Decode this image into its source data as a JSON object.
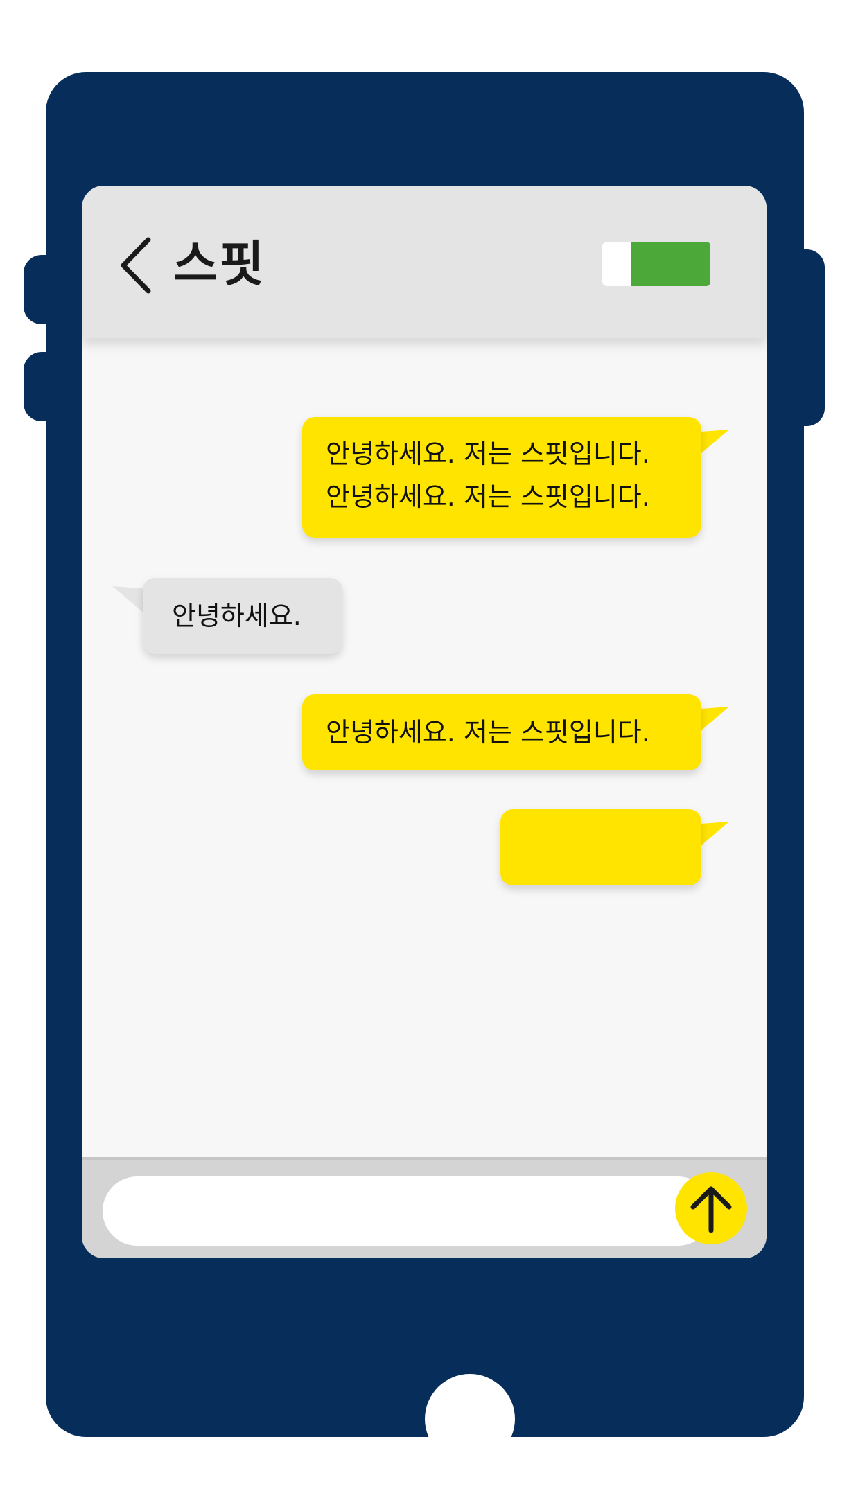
{
  "header": {
    "contact_name": "스핏",
    "back_icon": "chevron-left-icon"
  },
  "toggle": {
    "state": "on",
    "on_color": "#4da83a"
  },
  "messages": [
    {
      "sender": "me",
      "lines": [
        "안녕하세요. 저는 스핏입니다.",
        "안녕하세요. 저는 스핏입니다."
      ]
    },
    {
      "sender": "other",
      "lines": [
        "안녕하세요."
      ]
    },
    {
      "sender": "me",
      "lines": [
        "안녕하세요. 저는 스핏입니다."
      ]
    },
    {
      "sender": "me",
      "lines": []
    }
  ],
  "composer": {
    "value": "",
    "placeholder": "",
    "send_icon": "arrow-up-icon"
  },
  "colors": {
    "phone_body": "#072d5a",
    "sent_bubble": "#ffe400",
    "received_bubble": "#e4e4e4",
    "screen_background": "#f7f7f7"
  }
}
